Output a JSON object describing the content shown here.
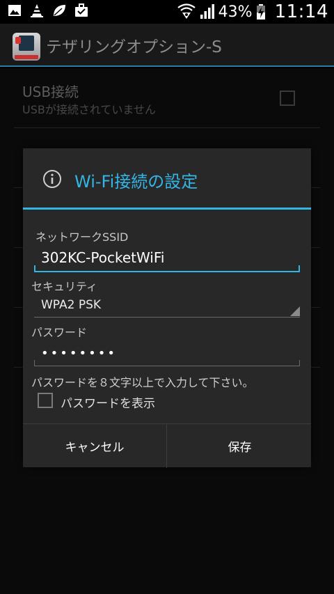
{
  "status_bar": {
    "battery_percent": "43%",
    "time": "11:14",
    "icons": [
      "image-icon",
      "vlc-cone-icon",
      "leaf-icon",
      "briefcase-icon",
      "wifi-tethering-icon",
      "signal-icon",
      "battery-charging-icon"
    ]
  },
  "action_bar": {
    "title": "テザリングオプション-S",
    "icon": "pocket-wifi-app-icon"
  },
  "background_list": {
    "usb": {
      "title": "USB接続",
      "subtitle": "USBが接続されていません",
      "checked": false
    }
  },
  "dialog": {
    "title": "Wi-Fi接続の設定",
    "icon": "info-icon",
    "ssid_label": "ネットワークSSID",
    "ssid_value": "302KC-PocketWiFi",
    "security_label": "セキュリティ",
    "security_value": "WPA2 PSK",
    "password_label": "パスワード",
    "password_value": "••••••••",
    "password_hint": "パスワードを８文字以上で入力して下さい。",
    "show_password_label": "パスワードを表示",
    "show_password_checked": false,
    "cancel_label": "キャンセル",
    "save_label": "保存"
  },
  "colors": {
    "accent": "#33b5e5",
    "dialog_bg": "#282828",
    "action_bar_bg": "#191919"
  }
}
